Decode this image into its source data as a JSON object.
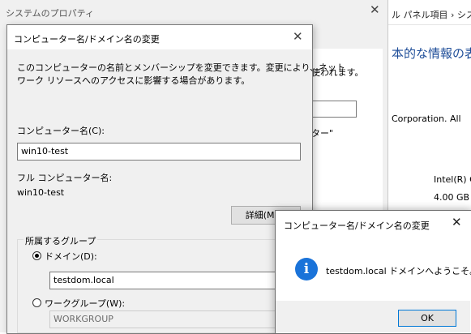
{
  "control_panel": {
    "breadcrumb": "ル パネル項目 › シス",
    "heading": "本的な情報の表示",
    "copyright_text": "Corporation. All",
    "processor_text": "Intel(R) C",
    "ram_text": "4.00 GB"
  },
  "system_properties": {
    "title": "システムのプロパティ",
    "partial_text_1": "使われます。",
    "partial_text_2": "ター\""
  },
  "rename_dialog": {
    "title": "コンピューター名/ドメイン名の変更",
    "description_line1": "このコンピューターの名前とメンバーシップを変更できます。変更により、ネット",
    "description_line2": "ワーク リソースへのアクセスに影響する場合があります。",
    "computer_name_label": "コンピューター名(C):",
    "computer_name_value": "win10-test",
    "full_name_label": "フル コンピューター名:",
    "full_name_value": "win10-test",
    "details_button": "詳細(M)...",
    "member_of_label": "所属するグループ",
    "domain_label": "ドメイン(D):",
    "domain_value": "testdom.local",
    "workgroup_label": "ワークグループ(W):",
    "workgroup_value": "WORKGROUP",
    "selected_membership": "domain"
  },
  "welcome_dialog": {
    "title": "コンピューター名/ドメイン名の変更",
    "message": "testdom.local ドメインへようこそ。",
    "ok_button": "OK",
    "icon": "info-icon"
  },
  "colors": {
    "accent": "#0078d7",
    "info_icon": "#1a73d9",
    "heading_blue": "#1f4e99"
  }
}
